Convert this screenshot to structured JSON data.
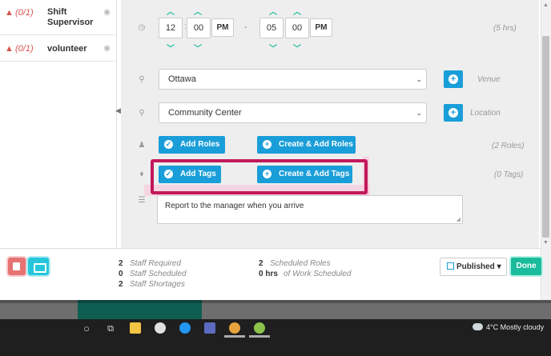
{
  "left_panel": {
    "roles": [
      {
        "count": "(0/1)",
        "name": "Shift Supervisor"
      },
      {
        "count": "(0/1)",
        "name": "volunteer"
      }
    ]
  },
  "time": {
    "start_hour": "12",
    "start_minute": "00",
    "start_ampm": "PM",
    "end_hour": "05",
    "end_minute": "00",
    "end_ampm": "PM",
    "separator": ":",
    "dash": "-",
    "duration": "(5 hrs)"
  },
  "venue": {
    "value": "Ottawa",
    "hint": "Venue"
  },
  "location": {
    "value": "Community Center",
    "hint": "Location"
  },
  "roles": {
    "add_label": "Add Roles",
    "create_label": "Create & Add Roles",
    "count": "(2 Roles)"
  },
  "tags": {
    "add_label": "Add Tags",
    "create_label": "Create & Add Tags",
    "count": "(0 Tags)"
  },
  "notes": {
    "value": "Report to the manager when you arrive"
  },
  "footer": {
    "stats_left": [
      {
        "num": "2",
        "label": "Staff Required"
      },
      {
        "num": "0",
        "label": "Staff Scheduled"
      },
      {
        "num": "2",
        "label": "Staff Shortages"
      }
    ],
    "stats_right": [
      {
        "num": "2",
        "label": "Scheduled Roles"
      },
      {
        "num": "0 hrs",
        "label": "of Work Scheduled"
      }
    ],
    "published_label": "Published",
    "done_label": "Done"
  },
  "taskbar": {
    "weather_text": "4°C  Mostly cloudy"
  },
  "colors": {
    "primary": "#1a9ed9",
    "accent": "#1abc9c",
    "warning": "#d9534f",
    "highlight": "#c2185b"
  }
}
